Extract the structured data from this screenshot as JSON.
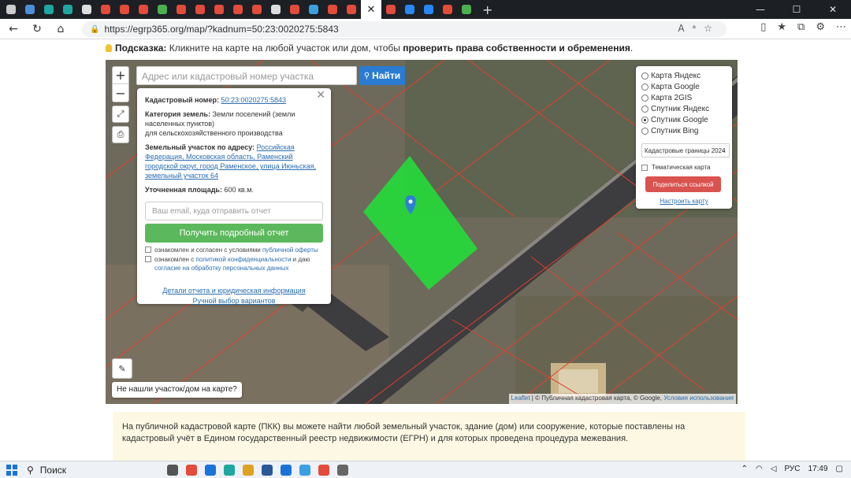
{
  "browser": {
    "tab_colors": [
      "#cccccc",
      "#4a90d9",
      "#1ea7a0",
      "#1ea7a0",
      "#dddddd",
      "#e34b3a",
      "#e34b3a",
      "#e34b3a",
      "#4caf50",
      "#e34b3a",
      "#e34b3a",
      "#e34b3a",
      "#e34b3a",
      "#e34b3a",
      "#dddddd",
      "#e34b3a",
      "#3aa0e0",
      "#e34b3a",
      "#e34b3a",
      "#cccccc",
      "#e34b3a",
      "#2787f5",
      "#2787f5",
      "#e34b3a",
      "#4caf50"
    ],
    "url": "https://egrp365.org/map/?kadnum=50:23:0020275:5843"
  },
  "hint": {
    "label": "Подсказка:",
    "text": " Кликните на карте на любой участок или дом, чтобы ",
    "bold": "проверить права собственности и обременения",
    "end": "."
  },
  "map": {
    "search_placeholder": "Адрес или кадастровый номер участка",
    "find_label": "Найти",
    "not_found": "Не нашли участок/дом на карте?",
    "attribution_leaflet": "Leaflet",
    "attribution_text": " | © Публичная кадастровая карта, © Google, ",
    "attribution_terms": "Условия использования"
  },
  "popup": {
    "cadnum_label": "Кадастровый номер:",
    "cadnum_value": "50:23:0020275:5843",
    "category_label": "Категория земель:",
    "category_value": " Земли поселений (земли населенных пунктов)",
    "category_use": "для сельскохозяйственного производства",
    "address_label": "Земельный участок по адресу:",
    "address_value": "Российская Федерация, Московская область, Раменский городской округ, город Раменское, улица Июньская, земельный участок 64",
    "area_label": "Уточненная площадь:",
    "area_value": " 600 кв.м.",
    "email_placeholder": "Ваш email, куда отправить отчет",
    "report_button": "Получить подробный отчет",
    "consent1_text": "ознакомлен и согласен с условиями ",
    "consent1_link": "публичной оферты",
    "consent2_text": "ознакомлен с ",
    "consent2_link": "политикой конфиденциальности",
    "consent2_mid": " и даю ",
    "consent2_link2": "согласие на обработку персональных данных",
    "details_link": "Детали отчета и юридическая информация",
    "manual_link": "Ручной выбор вариантов"
  },
  "layers": {
    "options": [
      {
        "label": "Карта Яндекс",
        "selected": false
      },
      {
        "label": "Карта Google",
        "selected": false
      },
      {
        "label": "Карта 2GIS",
        "selected": false
      },
      {
        "label": "Спутник Яндекс",
        "selected": false
      },
      {
        "label": "Спутник Google",
        "selected": true
      },
      {
        "label": "Спутник Bing",
        "selected": false
      }
    ],
    "boundaries_select": "Кадастровые границы 2024",
    "thematic_label": "Тематическая карта",
    "share_button": "Поделиться ссылкой",
    "setup_link": "Настроить карту"
  },
  "info": {
    "text": "На публичной кадастровой карте (ПКК) вы можете найти любой земельный участок, здание (дом) или сооружение, которые поставлены на кадастровый учёт в Едином государственный реестр недвижимости (ЕГРН) и для которых проведена процедура межевания."
  },
  "taskbar": {
    "search_label": "Поиск",
    "app_colors": [
      "#555555",
      "#e34b3a",
      "#1a73d9",
      "#1ea7a0",
      "#e0a020",
      "#2b5797",
      "#1a73d9",
      "#3aa0e0",
      "#e34b3a",
      "#666666"
    ],
    "lang": "РУС",
    "time": "17:49"
  }
}
